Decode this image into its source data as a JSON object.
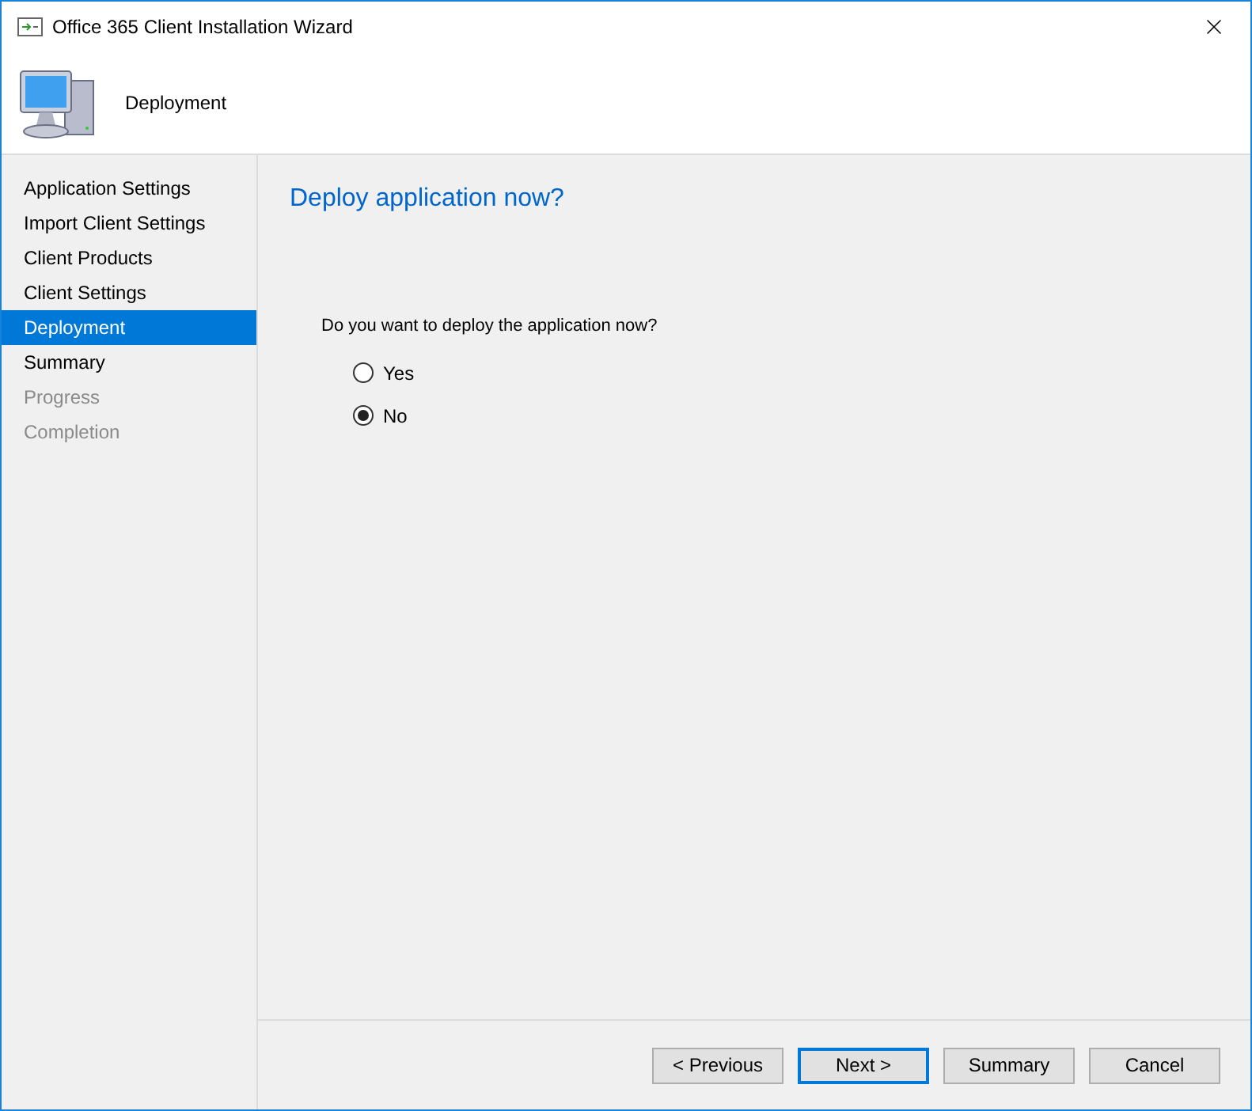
{
  "window": {
    "title": "Office 365 Client Installation Wizard"
  },
  "header": {
    "title": "Deployment"
  },
  "steps": [
    {
      "label": "Application Settings",
      "selected": false,
      "disabled": false
    },
    {
      "label": "Import Client Settings",
      "selected": false,
      "disabled": false
    },
    {
      "label": "Client Products",
      "selected": false,
      "disabled": false
    },
    {
      "label": "Client Settings",
      "selected": false,
      "disabled": false
    },
    {
      "label": "Deployment",
      "selected": true,
      "disabled": false
    },
    {
      "label": "Summary",
      "selected": false,
      "disabled": false
    },
    {
      "label": "Progress",
      "selected": false,
      "disabled": true
    },
    {
      "label": "Completion",
      "selected": false,
      "disabled": true
    }
  ],
  "page": {
    "heading": "Deploy application now?",
    "question": "Do you want to deploy the application now?",
    "options": [
      {
        "label": "Yes",
        "selected": false
      },
      {
        "label": "No",
        "selected": true
      }
    ]
  },
  "buttons": [
    {
      "label": "< Previous",
      "default": false
    },
    {
      "label": "Next >",
      "default": true
    },
    {
      "label": "Summary",
      "default": false
    },
    {
      "label": "Cancel",
      "default": false
    }
  ]
}
